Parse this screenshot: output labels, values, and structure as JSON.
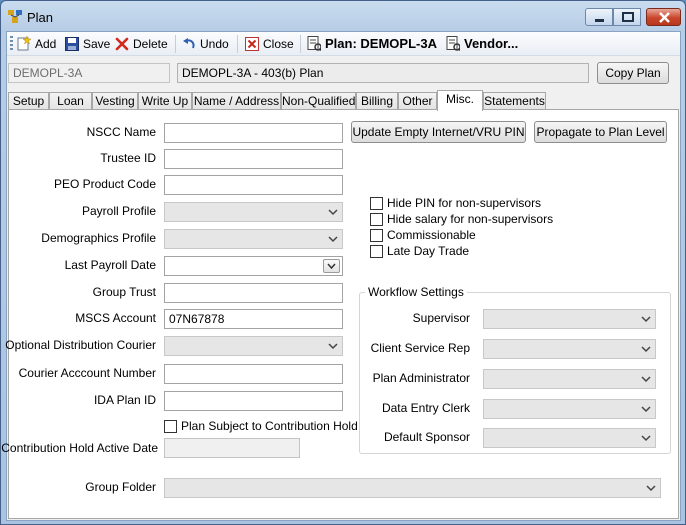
{
  "window": {
    "title": "Plan"
  },
  "toolbar": {
    "add_label": "Add",
    "save_label": "Save",
    "delete_label": "Delete",
    "undo_label": "Undo",
    "close_label": "Close",
    "plan_label": "Plan: DEMOPL-3A",
    "vendor_label": "Vendor..."
  },
  "header": {
    "plan_code": "DEMOPL-3A",
    "plan_description": "DEMOPL-3A  - 403(b) Plan",
    "copy_plan_label": "Copy Plan"
  },
  "tabs": [
    {
      "label": "Setup"
    },
    {
      "label": "Loan"
    },
    {
      "label": "Vesting"
    },
    {
      "label": "Write Up"
    },
    {
      "label": "Name / Address"
    },
    {
      "label": "Non-Qualified"
    },
    {
      "label": "Billing"
    },
    {
      "label": "Other"
    },
    {
      "label": "Misc."
    },
    {
      "label": "Statements"
    }
  ],
  "active_tab": "Misc.",
  "form": {
    "nscc_name": {
      "label": "NSCC Name",
      "value": ""
    },
    "trustee_id": {
      "label": "Trustee ID",
      "value": ""
    },
    "peo_product_code": {
      "label": "PEO Product Code",
      "value": ""
    },
    "payroll_profile": {
      "label": "Payroll Profile",
      "value": ""
    },
    "demographics_profile": {
      "label": "Demographics Profile",
      "value": ""
    },
    "last_payroll_date": {
      "label": "Last Payroll Date",
      "value": ""
    },
    "group_trust": {
      "label": "Group Trust",
      "value": ""
    },
    "mscs_account": {
      "label": "MSCS Account",
      "value": "07N67878"
    },
    "optional_distribution_courier": {
      "label": "Optional Distribution Courier",
      "value": ""
    },
    "courier_account_number": {
      "label": "Courier Acccount Number",
      "value": ""
    },
    "ida_plan_id": {
      "label": "IDA Plan ID",
      "value": ""
    },
    "plan_subject_to_contribution_hold": {
      "label": "Plan Subject to Contribution Hold",
      "checked": false
    },
    "contribution_hold_active_date": {
      "label": "Contribution Hold Active Date",
      "value": ""
    },
    "group_folder": {
      "label": "Group Folder",
      "value": ""
    }
  },
  "actions": {
    "update_pin_label": "Update  Empty  Internet/VRU PIN",
    "propagate_label": "Propagate  to  Plan Level"
  },
  "options": [
    {
      "label": "Hide PIN for non-supervisors",
      "checked": false
    },
    {
      "label": "Hide salary for non-supervisors",
      "checked": false
    },
    {
      "label": "Commissionable",
      "checked": false
    },
    {
      "label": "Late Day Trade",
      "checked": false
    }
  ],
  "workflow": {
    "title": "Workflow Settings",
    "supervisor": {
      "label": "Supervisor",
      "value": ""
    },
    "client_service_rep": {
      "label": "Client Service Rep",
      "value": ""
    },
    "plan_administrator": {
      "label": "Plan Administrator",
      "value": ""
    },
    "data_entry_clerk": {
      "label": "Data Entry Clerk",
      "value": ""
    },
    "default_sponsor": {
      "label": "Default Sponsor",
      "value": ""
    }
  }
}
